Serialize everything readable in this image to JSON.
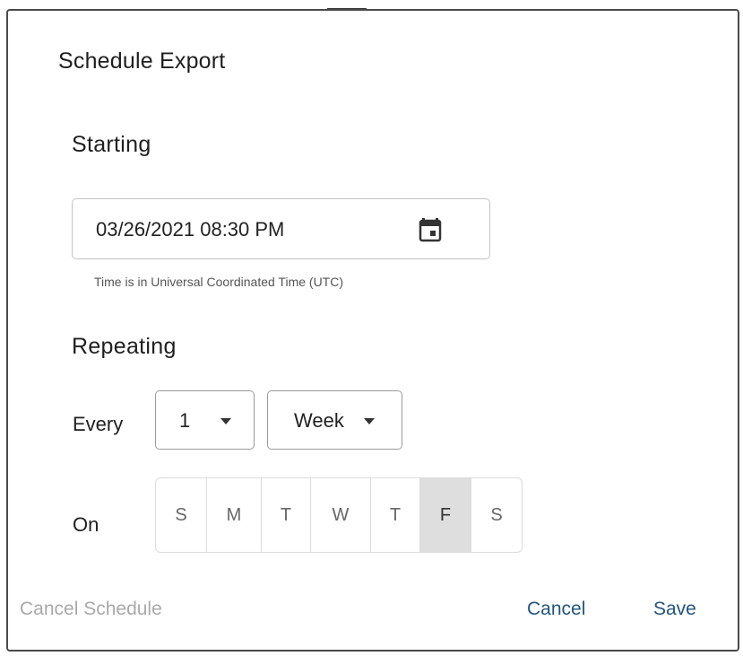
{
  "dialog": {
    "title": "Schedule Export"
  },
  "starting": {
    "heading": "Starting",
    "datetime_value": "03/26/2021 08:30 PM",
    "helper_text": "Time is in Universal Coordinated Time (UTC)",
    "icon": "calendar-icon"
  },
  "repeating": {
    "heading": "Repeating",
    "every_label": "Every",
    "interval_value": "1",
    "unit_value": "Week",
    "on_label": "On",
    "days": [
      {
        "label": "S",
        "selected": false
      },
      {
        "label": "M",
        "selected": false
      },
      {
        "label": "T",
        "selected": false
      },
      {
        "label": "W",
        "selected": false
      },
      {
        "label": "T",
        "selected": false
      },
      {
        "label": "F",
        "selected": true
      },
      {
        "label": "S",
        "selected": false
      }
    ]
  },
  "footer": {
    "cancel_schedule_label": "Cancel Schedule",
    "cancel_label": "Cancel",
    "save_label": "Save"
  },
  "colors": {
    "link": "#23557f",
    "disabled_link": "#a9a9a9",
    "selected_day_bg": "#dedede"
  }
}
